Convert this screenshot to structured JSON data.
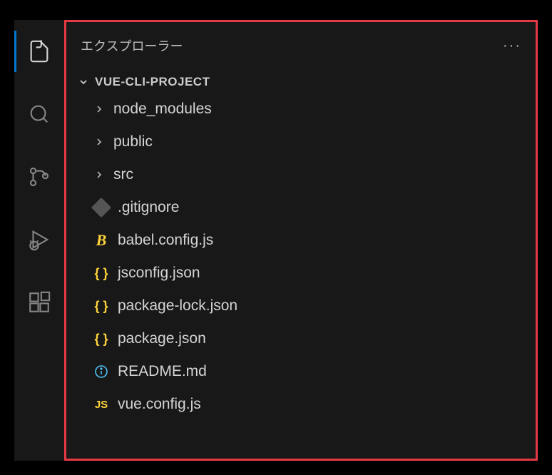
{
  "sidebar": {
    "title": "エクスプローラー",
    "projectName": "VUE-CLI-PROJECT"
  },
  "tree": {
    "folders": [
      {
        "name": "node_modules"
      },
      {
        "name": "public"
      },
      {
        "name": "src"
      }
    ],
    "files": [
      {
        "name": ".gitignore",
        "iconType": "git"
      },
      {
        "name": "babel.config.js",
        "iconType": "babel"
      },
      {
        "name": "jsconfig.json",
        "iconType": "braces"
      },
      {
        "name": "package-lock.json",
        "iconType": "braces"
      },
      {
        "name": "package.json",
        "iconType": "braces"
      },
      {
        "name": "README.md",
        "iconType": "info"
      },
      {
        "name": "vue.config.js",
        "iconType": "js"
      }
    ]
  }
}
